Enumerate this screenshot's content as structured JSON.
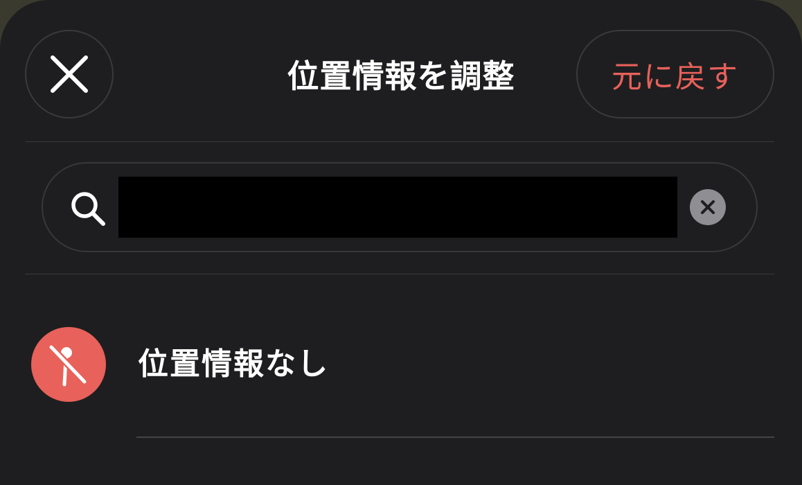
{
  "header": {
    "title": "位置情報を調整",
    "close_icon": "close-icon",
    "revert_label": "元に戻す"
  },
  "search": {
    "value": "",
    "search_icon": "search-icon",
    "clear_icon": "clear-circle-icon"
  },
  "options": {
    "no_location": {
      "label": "位置情報なし",
      "icon": "location-off-icon"
    }
  },
  "colors": {
    "background": "#1e1e20",
    "accent": "#e8615a",
    "divider": "#3a3a3d",
    "clear_button": "#8e8e93"
  }
}
